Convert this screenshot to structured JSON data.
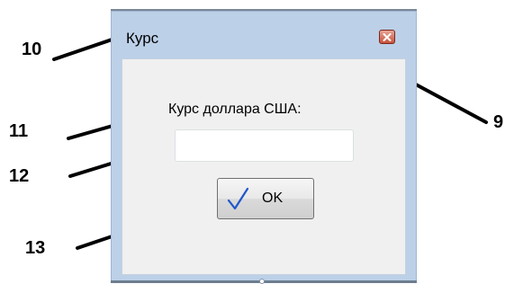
{
  "window": {
    "title": "Курс",
    "close_icon": "close-icon",
    "accent_color": "#bcd0e8"
  },
  "form": {
    "label": "Курс доллара США:",
    "input_value": "",
    "ok_button_label": "OK",
    "ok_icon": "checkmark-icon"
  },
  "callouts": {
    "c9": "9",
    "c10": "10",
    "c11": "11",
    "c12": "12",
    "c13": "13"
  }
}
